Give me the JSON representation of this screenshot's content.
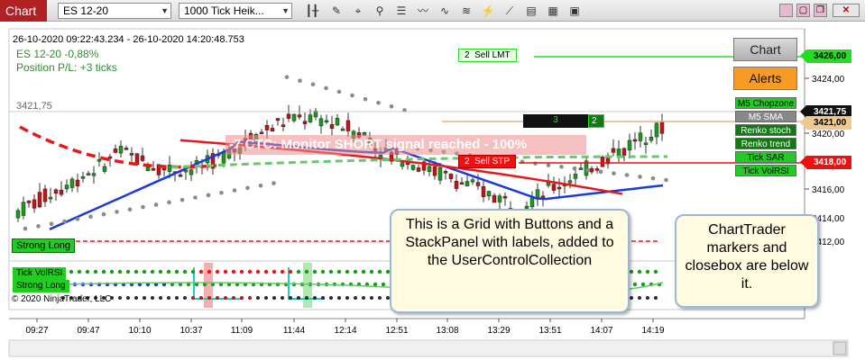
{
  "window": {
    "title": "Chart",
    "instrument": "ES 12-20",
    "bar_type": "1000 Tick Heik...",
    "colors": {
      "title_bg": "#b12124"
    }
  },
  "chart_header": {
    "date_range": "26-10-2020 09:22:43.234 - 26-10-2020 14:20:48.753",
    "instrument_change": "ES 12-20 -0,88%",
    "position_pl": "Position P/L: +3 ticks",
    "last_value": "3421,75"
  },
  "banner": {
    "text": "-7 CTC: Monitor SHORT signal reached - 100%"
  },
  "chart_trader": {
    "chart_button": "Chart",
    "alerts_button": "Alerts",
    "indicators": [
      {
        "label": "M5 Chopzone",
        "bg": "#22cc22",
        "fg": "#000000"
      },
      {
        "label": "M5 SMA",
        "bg": "#888888",
        "fg": "#ffffff"
      },
      {
        "label": "Renko stoch",
        "bg": "#117a11",
        "fg": "#ffffff"
      },
      {
        "label": "Renko trend",
        "bg": "#117a11",
        "fg": "#ffffff"
      },
      {
        "label": "Tick SAR",
        "bg": "#22cc22",
        "fg": "#000000"
      },
      {
        "label": "Tick VolRSI",
        "bg": "#22cc22",
        "fg": "#000000"
      }
    ]
  },
  "orders": {
    "sell_lmt": {
      "qty": "2",
      "label": "Sell LMT",
      "color": "#22dd22"
    },
    "sell_stp": {
      "qty": "2",
      "label": "Sell STP",
      "color": "#ee1111"
    },
    "position_qty": "3",
    "position_box": "2"
  },
  "price_axis": {
    "ticks": [
      "3426,00",
      "3424,00",
      "3422,00",
      "3420,00",
      "3418,00",
      "3416,00",
      "3414,00",
      "3412,00"
    ],
    "flags": [
      {
        "label": "3426,00",
        "bg": "#22dd22",
        "fg": "#000000"
      },
      {
        "label": "3421,75",
        "bg": "#111111",
        "fg": "#ffffff"
      },
      {
        "label": "3421,00",
        "bg": "#f0c890",
        "fg": "#000000"
      },
      {
        "label": "3418,00",
        "bg": "#ee1111",
        "fg": "#ffffff"
      }
    ]
  },
  "time_axis": {
    "labels": [
      "09:27",
      "09:47",
      "10:10",
      "10:37",
      "11:09",
      "11:44",
      "12:14",
      "12:51",
      "13:08",
      "13:29",
      "13:51",
      "14:07",
      "14:19"
    ]
  },
  "indicator_badges": {
    "strong_long_main": "Strong Long",
    "tick_volrsi": "Tick VolRSI",
    "strong_long_sub": "Strong Long"
  },
  "copyright": "© 2020 NinjaTrader, LLC",
  "callouts": {
    "grid": "This is a Grid with Buttons and a StackPanel with labels, added to  the UserControlCollection",
    "charttrader": "ChartTrader markers and closebox are below it."
  },
  "icons": [
    "chart-type-icon",
    "pencil-icon",
    "cursor-icon",
    "zoom-icon",
    "properties-icon",
    "indicator-icon",
    "strategy-icon",
    "chart-trader-icon",
    "minimize-icon",
    "maximize-icon",
    "close-icon"
  ]
}
